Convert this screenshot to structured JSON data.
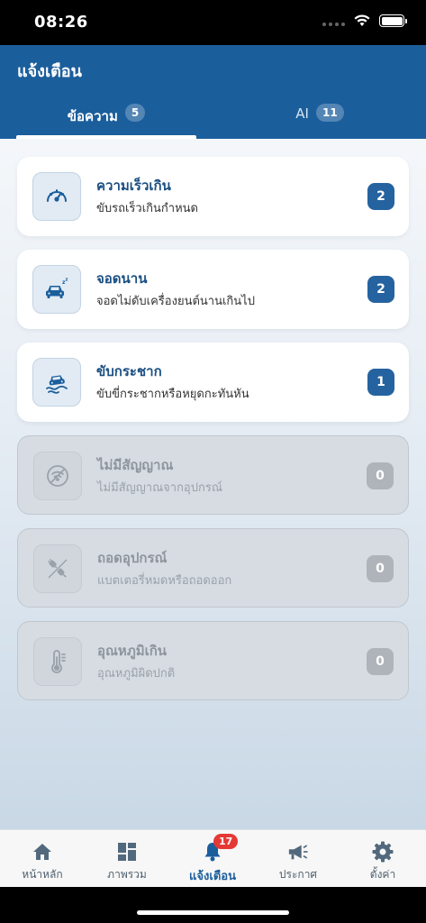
{
  "status": {
    "time": "08:26"
  },
  "header": {
    "title": "แจ้งเตือน"
  },
  "tabs": [
    {
      "label": "ข้อความ",
      "count": "5"
    },
    {
      "label": "AI",
      "count": "11"
    }
  ],
  "alerts": [
    {
      "title": "ความเร็วเกิน",
      "subtitle": "ขับรถเร็วเกินกำหนด",
      "count": "2",
      "icon": "speedometer-icon"
    },
    {
      "title": "จอดนาน",
      "subtitle": "จอดไม่ดับเครื่องยนต์นานเกินไป",
      "count": "2",
      "icon": "parked-car-icon"
    },
    {
      "title": "ขับกระชาก",
      "subtitle": "ขับขี่กระชากหรือหยุดกะทันหัน",
      "count": "1",
      "icon": "skidding-car-icon"
    },
    {
      "title": "ไม่มีสัญญาณ",
      "subtitle": "ไม่มีสัญญาณจากอุปกรณ์",
      "count": "0",
      "icon": "no-signal-icon"
    },
    {
      "title": "ถอดอุปกรณ์",
      "subtitle": "แบตเตอรี่หมดหรือถอดออก",
      "count": "0",
      "icon": "unplugged-icon"
    },
    {
      "title": "อุณหภูมิเกิน",
      "subtitle": "อุณหภูมิผิดปกติ",
      "count": "0",
      "icon": "thermometer-icon"
    }
  ],
  "nav": {
    "items": [
      {
        "label": "หน้าหลัก",
        "icon": "home-icon"
      },
      {
        "label": "ภาพรวม",
        "icon": "dashboard-icon"
      },
      {
        "label": "แจ้งเตือน",
        "icon": "bell-icon",
        "badge": "17"
      },
      {
        "label": "ประกาศ",
        "icon": "megaphone-icon"
      },
      {
        "label": "ตั้งค่า",
        "icon": "gear-icon"
      }
    ]
  },
  "colors": {
    "primary": "#1b5e9c",
    "badge": "#e53935",
    "disabled": "#aeb4ba"
  }
}
